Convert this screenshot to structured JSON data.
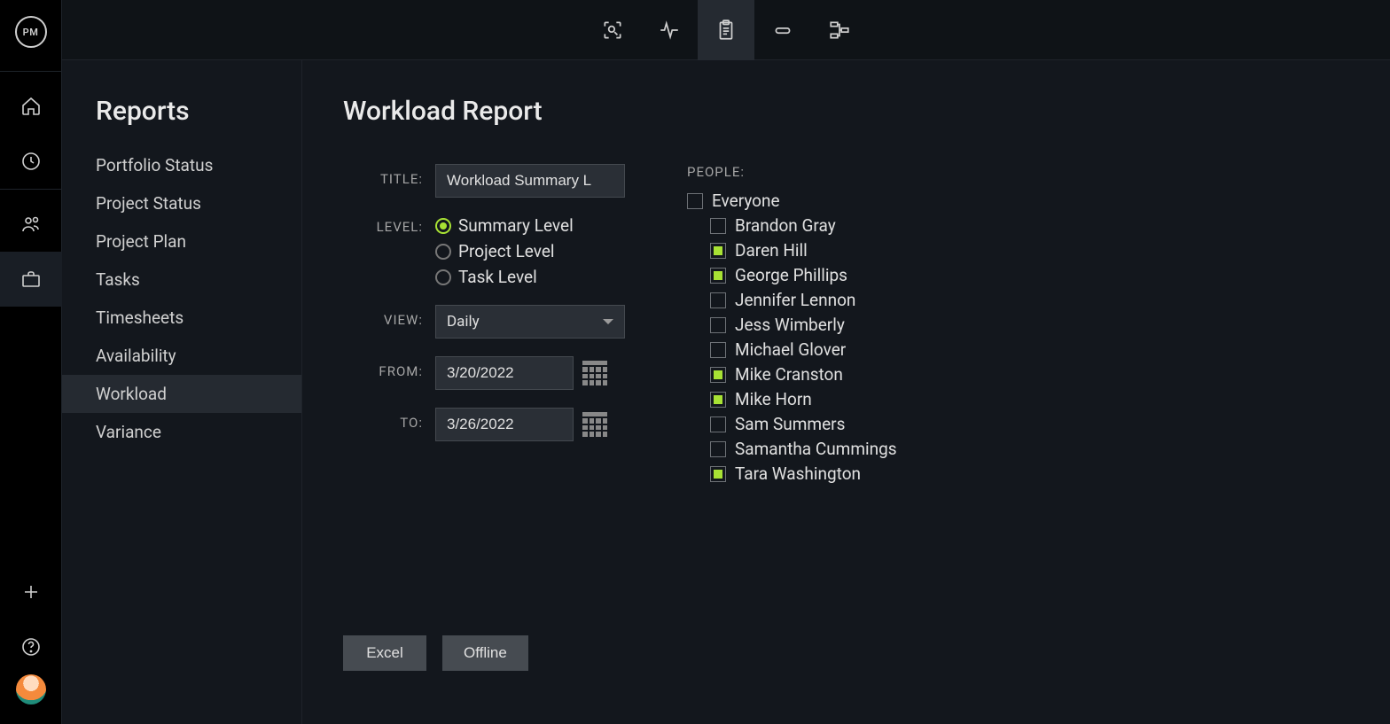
{
  "logo": "PM",
  "sidebar": {
    "title": "Reports",
    "items": [
      {
        "label": "Portfolio Status",
        "active": false
      },
      {
        "label": "Project Status",
        "active": false
      },
      {
        "label": "Project Plan",
        "active": false
      },
      {
        "label": "Tasks",
        "active": false
      },
      {
        "label": "Timesheets",
        "active": false
      },
      {
        "label": "Availability",
        "active": false
      },
      {
        "label": "Workload",
        "active": true
      },
      {
        "label": "Variance",
        "active": false
      }
    ]
  },
  "report": {
    "title": "Workload Report",
    "labels": {
      "title": "TITLE:",
      "level": "LEVEL:",
      "view": "VIEW:",
      "from": "FROM:",
      "to": "TO:",
      "people": "PEOPLE:"
    },
    "form": {
      "title_value": "Workload Summary L",
      "levels": [
        {
          "label": "Summary Level",
          "checked": true
        },
        {
          "label": "Project Level",
          "checked": false
        },
        {
          "label": "Task Level",
          "checked": false
        }
      ],
      "view_value": "Daily",
      "from_value": "3/20/2022",
      "to_value": "3/26/2022"
    },
    "people": {
      "everyone_label": "Everyone",
      "everyone_checked": false,
      "list": [
        {
          "label": "Brandon Gray",
          "checked": false
        },
        {
          "label": "Daren Hill",
          "checked": true
        },
        {
          "label": "George Phillips",
          "checked": true
        },
        {
          "label": "Jennifer Lennon",
          "checked": false
        },
        {
          "label": "Jess Wimberly",
          "checked": false
        },
        {
          "label": "Michael Glover",
          "checked": false
        },
        {
          "label": "Mike Cranston",
          "checked": true
        },
        {
          "label": "Mike Horn",
          "checked": true
        },
        {
          "label": "Sam Summers",
          "checked": false
        },
        {
          "label": "Samantha Cummings",
          "checked": false
        },
        {
          "label": "Tara Washington",
          "checked": true
        }
      ]
    },
    "buttons": {
      "excel": "Excel",
      "offline": "Offline"
    }
  }
}
